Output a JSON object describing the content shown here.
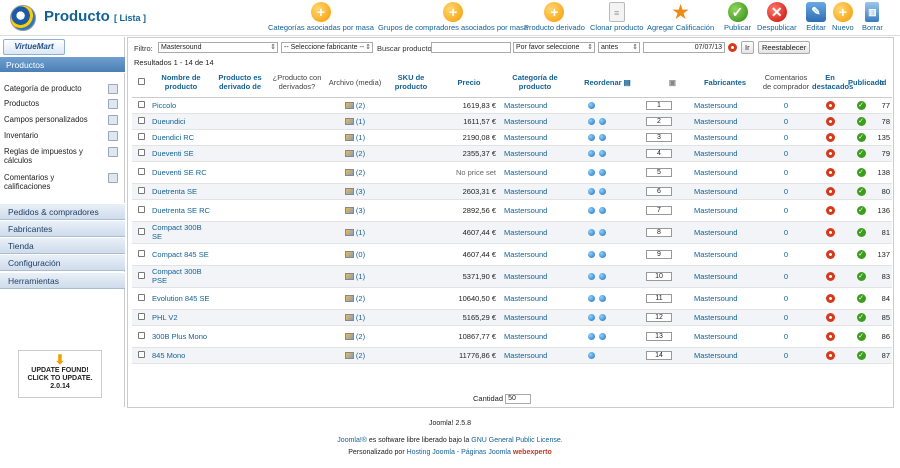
{
  "header": {
    "title": "Producto",
    "subtitle": "[ Lista ]"
  },
  "toolbar": [
    {
      "label": "Categorías asociadas por masa",
      "icon": "plus-icon",
      "kind": "orange"
    },
    {
      "label": "Grupos de compradores asociados por masa",
      "icon": "plus-icon",
      "kind": "orange"
    },
    {
      "label": "Producto derivado",
      "icon": "plus-icon",
      "kind": "orange"
    },
    {
      "label": "Clonar producto",
      "icon": "document-icon",
      "kind": "doc"
    },
    {
      "label": "Agregar Calificación",
      "icon": "star-icon",
      "kind": "star"
    },
    {
      "label": "Publicar",
      "icon": "check-icon",
      "kind": "green"
    },
    {
      "label": "Despublicar",
      "icon": "x-icon",
      "kind": "red"
    },
    {
      "label": "Editar",
      "icon": "pencil-icon",
      "kind": "blue"
    },
    {
      "label": "Nuevo",
      "icon": "plus-icon",
      "kind": "orange"
    },
    {
      "label": "Borrar",
      "icon": "trash-icon",
      "kind": "bin"
    }
  ],
  "sidebar": {
    "brand": "VirtueMart",
    "active_section": "Productos",
    "items": [
      {
        "label": "Categoría de producto"
      },
      {
        "label": "Productos"
      },
      {
        "label": "Campos personalizados"
      },
      {
        "label": "Inventario"
      },
      {
        "label": "Reglas de impuestos y cálculos"
      },
      {
        "label": "Comentarios y calificaciones"
      }
    ],
    "sections": [
      "Pedidos & compradores",
      "Fabricantes",
      "Tienda",
      "Configuración",
      "Herramientas"
    ],
    "update_notice": {
      "line1": "UPDATE FOUND!",
      "line2": "CLICK TO UPDATE.",
      "line3": "2.0.14"
    }
  },
  "filters": {
    "label": "Filtro:",
    "category": "Mastersound",
    "manufacturer": "-- Seleccione fabricante --",
    "search_label": "Buscar producto",
    "search_value": "",
    "date_type": "Por favor seleccione",
    "date_relation": "antes",
    "date_value": "07/07/13",
    "go_label": "Ir",
    "reset_label": "Reestablecer"
  },
  "results_text": "Resultados 1 - 14 de 14",
  "columns": [
    "Nombre de producto",
    "Producto es derivado de",
    "¿Producto con derivados?",
    "Archivo (media)",
    "SKU de producto",
    "Precio",
    "Categoría de producto",
    "Reordenar",
    "Fabricantes",
    "Comentarios de comprador",
    "En destacados",
    "Publicado",
    "Id"
  ],
  "rows": [
    {
      "name": "Piccolo",
      "media": "(2)",
      "price": "1619,83 €",
      "category": "Mastersound",
      "dots": 1,
      "order": "1",
      "manufacturer": "Mastersound",
      "comments": "0",
      "id": "77"
    },
    {
      "name": "Dueundici",
      "media": "(1)",
      "price": "1611,57 €",
      "category": "Mastersound",
      "dots": 2,
      "order": "2",
      "manufacturer": "Mastersound",
      "comments": "0",
      "id": "78"
    },
    {
      "name": "Duendici RC",
      "media": "(1)",
      "price": "2190,08 €",
      "category": "Mastersound",
      "dots": 2,
      "order": "3",
      "manufacturer": "Mastersound",
      "comments": "0",
      "id": "135"
    },
    {
      "name": "Dueventi SE",
      "media": "(2)",
      "price": "2355,37 €",
      "category": "Mastersound",
      "dots": 2,
      "order": "4",
      "manufacturer": "Mastersound",
      "comments": "0",
      "id": "79"
    },
    {
      "name": "Dueventi SE RC",
      "media": "(2)",
      "price": "No price set",
      "category": "Mastersound",
      "dots": 2,
      "order": "5",
      "manufacturer": "Mastersound",
      "comments": "0",
      "id": "138"
    },
    {
      "name": "Duetrenta SE",
      "media": "(3)",
      "price": "2603,31 €",
      "category": "Mastersound",
      "dots": 2,
      "order": "6",
      "manufacturer": "Mastersound",
      "comments": "0",
      "id": "80"
    },
    {
      "name": "Duetrenta SE RC",
      "media": "(3)",
      "price": "2892,56 €",
      "category": "Mastersound",
      "dots": 2,
      "order": "7",
      "manufacturer": "Mastersound",
      "comments": "0",
      "id": "136"
    },
    {
      "name": "Compact 300B SE",
      "media": "(1)",
      "price": "4607,44 €",
      "category": "Mastersound",
      "dots": 2,
      "order": "8",
      "manufacturer": "Mastersound",
      "comments": "0",
      "id": "81"
    },
    {
      "name": "Compact 845 SE",
      "media": "(0)",
      "price": "4607,44 €",
      "category": "Mastersound",
      "dots": 2,
      "order": "9",
      "manufacturer": "Mastersound",
      "comments": "0",
      "id": "137"
    },
    {
      "name": "Compact 300B PSE",
      "media": "(1)",
      "price": "5371,90 €",
      "category": "Mastersound",
      "dots": 2,
      "order": "10",
      "manufacturer": "Mastersound",
      "comments": "0",
      "id": "83"
    },
    {
      "name": "Evolution 845 SE",
      "media": "(2)",
      "price": "10640,50 €",
      "category": "Mastersound",
      "dots": 2,
      "order": "11",
      "manufacturer": "Mastersound",
      "comments": "0",
      "id": "84"
    },
    {
      "name": "PHL V2",
      "media": "(1)",
      "price": "5165,29 €",
      "category": "Mastersound",
      "dots": 2,
      "order": "12",
      "manufacturer": "Mastersound",
      "comments": "0",
      "id": "85"
    },
    {
      "name": "300B Plus Mono",
      "media": "(2)",
      "price": "10867,77 €",
      "category": "Mastersound",
      "dots": 2,
      "order": "13",
      "manufacturer": "Mastersound",
      "comments": "0",
      "id": "86"
    },
    {
      "name": "845 Mono",
      "media": "(2)",
      "price": "11776,86 €",
      "category": "Mastersound",
      "dots": 1,
      "order": "14",
      "manufacturer": "Mastersound",
      "comments": "0",
      "id": "87"
    }
  ],
  "pagination": {
    "label": "Cantidad",
    "value": "50"
  },
  "footer": {
    "version": "Joomla! 2.5.8",
    "line2_a": "Joomla!®",
    "line2_b": " es software libre liberado bajo la ",
    "line2_c": "GNU General Public License.",
    "line3_a": "Personalizado por ",
    "line3_b": "Hosting Joomla - Páginas Joomla",
    "line3_c": "webexperto"
  }
}
